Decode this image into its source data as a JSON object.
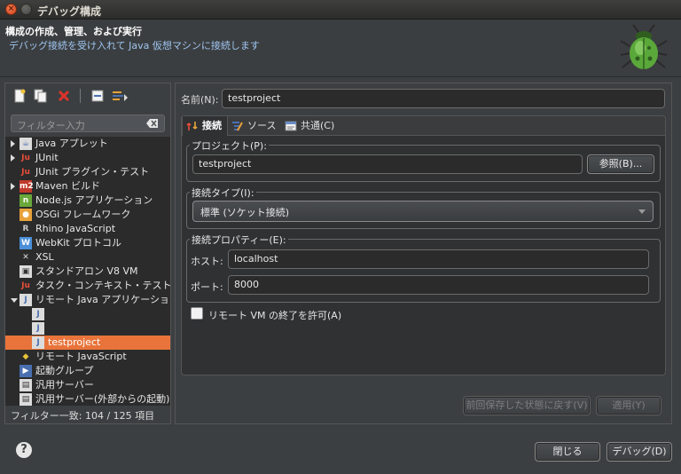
{
  "window": {
    "title": "デバッグ構成"
  },
  "header": {
    "title": "構成の作成、管理、および実行",
    "description": "デバッグ接続を受け入れて Java 仮想マシンに接続します"
  },
  "left": {
    "filter_placeholder": "フィルター入力",
    "tree": [
      {
        "label": "Java アプレット",
        "icon": "java-applet-icon",
        "arrow": "right",
        "indent": 0
      },
      {
        "label": "JUnit",
        "icon": "junit-icon",
        "arrow": "right",
        "indent": 0
      },
      {
        "label": "JUnit プラグイン・テスト",
        "icon": "junit-plugin-icon",
        "arrow": "",
        "indent": 0
      },
      {
        "label": "Maven ビルド",
        "icon": "maven-icon",
        "arrow": "right",
        "indent": 0
      },
      {
        "label": "Node.js アプリケーション",
        "icon": "nodejs-icon",
        "arrow": "",
        "indent": 0
      },
      {
        "label": "OSGi フレームワーク",
        "icon": "osgi-icon",
        "arrow": "",
        "indent": 0
      },
      {
        "label": "Rhino JavaScript",
        "icon": "rhino-icon",
        "arrow": "",
        "indent": 0
      },
      {
        "label": "WebKit プロトコル",
        "icon": "webkit-icon",
        "arrow": "",
        "indent": 0
      },
      {
        "label": "XSL",
        "icon": "xsl-icon",
        "arrow": "",
        "indent": 0
      },
      {
        "label": "スタンドアロン V8 VM",
        "icon": "v8-icon",
        "arrow": "",
        "indent": 0
      },
      {
        "label": "タスク・コンテキスト・テスト",
        "icon": "task-context-icon",
        "arrow": "",
        "indent": 0
      },
      {
        "label": "リモート Java アプリケーション",
        "icon": "remote-java-icon",
        "arrow": "down",
        "indent": 0
      },
      {
        "label": "",
        "icon": "remote-java-config-icon",
        "arrow": "",
        "indent": 1
      },
      {
        "label": "",
        "icon": "remote-java-config-icon",
        "arrow": "",
        "indent": 1
      },
      {
        "label": "testproject",
        "icon": "remote-java-config-icon",
        "arrow": "",
        "indent": 1,
        "selected": true
      },
      {
        "label": "リモート JavaScript",
        "icon": "remote-javascript-icon",
        "arrow": "",
        "indent": 0
      },
      {
        "label": "起動グループ",
        "icon": "launch-group-icon",
        "arrow": "",
        "indent": 0
      },
      {
        "label": "汎用サーバー",
        "icon": "generic-server-icon",
        "arrow": "",
        "indent": 0
      },
      {
        "label": "汎用サーバー(外部からの起動)",
        "icon": "generic-server-external-icon",
        "arrow": "",
        "indent": 0
      }
    ],
    "filter_status": "フィルター一致: 104 / 125 項目"
  },
  "right": {
    "name_label": "名前(N):",
    "name_value": "testproject",
    "tabs": [
      {
        "label": "接続",
        "icon": "connect-icon",
        "active": true
      },
      {
        "label": "ソース",
        "icon": "source-icon",
        "active": false
      },
      {
        "label": "共通(C)",
        "icon": "common-icon",
        "active": false
      }
    ],
    "project_group": "プロジェクト(P):",
    "project_value": "testproject",
    "browse_button": "参照(B)...",
    "connection_type_group": "接続タイプ(I):",
    "connection_type_value": "標準 (ソケット接続)",
    "connection_props_group": "接続プロパティー(E):",
    "host_label": "ホスト:",
    "host_value": "localhost",
    "port_label": "ポート:",
    "port_value": "8000",
    "allow_terminate_label": "リモート VM の終了を許可(A)",
    "revert_button": "前回保存した状態に戻す(V)",
    "apply_button": "適用(Y)"
  },
  "footer": {
    "help": "?",
    "close_button": "閉じる",
    "debug_button": "デバッグ(D)"
  }
}
